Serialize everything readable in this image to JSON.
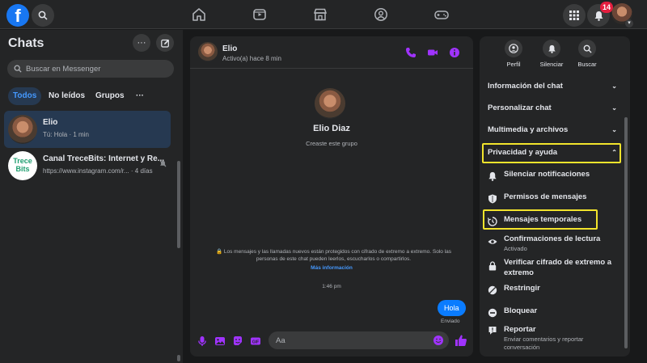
{
  "topbar": {
    "logo_letter": "f",
    "notification_count": "14",
    "nav_icons": [
      "home-icon",
      "watch-icon",
      "marketplace-icon",
      "groups-icon",
      "gaming-icon"
    ]
  },
  "sidebar": {
    "title": "Chats",
    "search_placeholder": "Buscar en Messenger",
    "filters": [
      {
        "label": "Todos",
        "active": true
      },
      {
        "label": "No leídos",
        "active": false
      },
      {
        "label": "Grupos",
        "active": false
      },
      {
        "label": "···",
        "active": false
      }
    ],
    "chats": [
      {
        "name": "Elio",
        "preview": "Tú: Hola · 1 min",
        "active": true
      },
      {
        "name": "Canal TreceBits: Internet y Re...",
        "preview": "https://www.instagram.com/r... · 4 días",
        "active": false,
        "logo_text": [
          "Trece",
          "Bits"
        ]
      }
    ]
  },
  "conversation": {
    "contact_name": "Elio",
    "contact_status": "Activo(a) hace 8 min",
    "profile_name": "Elio Diaz",
    "profile_subtitle": "Creaste este grupo",
    "e2e_note": "🔒 Los mensajes y las llamadas nuevos están protegidos con cifrado de extremo a extremo. Solo las personas de este chat pueden leerlos, escucharlos o compartirlos.",
    "more_info": "Más información",
    "timestamp": "1:46 pm",
    "messages": [
      {
        "text": "Hola",
        "status": "Enviado"
      }
    ],
    "composer_placeholder": "Aa",
    "accent_color": "#a033ff"
  },
  "panel": {
    "actions": [
      {
        "label": "Perfil",
        "icon": "profile-icon"
      },
      {
        "label": "Silenciar",
        "icon": "bell-icon"
      },
      {
        "label": "Buscar",
        "icon": "search-icon"
      }
    ],
    "sections": [
      {
        "label": "Información del chat",
        "expanded": false
      },
      {
        "label": "Personalizar chat",
        "expanded": false
      },
      {
        "label": "Multimedia y archivos",
        "expanded": false
      },
      {
        "label": "Privacidad y ayuda",
        "expanded": true
      }
    ],
    "privacy_items": [
      {
        "label": "Silenciar notificaciones",
        "icon": "bell-icon"
      },
      {
        "label": "Permisos de mensajes",
        "icon": "shield-icon"
      },
      {
        "label": "Mensajes temporales",
        "icon": "timer-icon"
      },
      {
        "label": "Confirmaciones de lectura",
        "sub": "Activado",
        "icon": "eye-icon"
      },
      {
        "label": "Verificar cifrado de extremo a",
        "label2": "extremo",
        "icon": "lock-icon"
      },
      {
        "label": "Restringir",
        "icon": "restrict-icon"
      },
      {
        "label": "Bloquear",
        "icon": "block-icon"
      },
      {
        "label": "Reportar",
        "sub": "Enviar comentarios y reportar",
        "sub2": "conversación",
        "icon": "report-icon"
      }
    ],
    "highlight_color": "#f2e42c"
  }
}
